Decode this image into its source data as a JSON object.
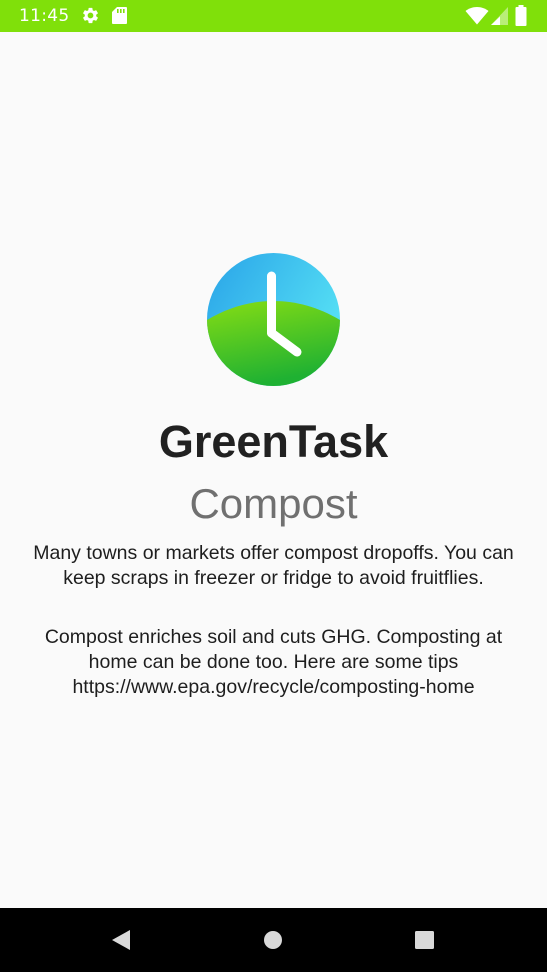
{
  "status_bar": {
    "time": "11:45",
    "background_color": "#80e00a",
    "left_icons": [
      "gear-icon",
      "sd-card-icon"
    ],
    "right_icons": [
      "wifi-icon",
      "cellular-signal-icon",
      "battery-icon"
    ]
  },
  "app": {
    "logo_icon": "clock-icon",
    "name": "GreenTask"
  },
  "screen": {
    "title": "Compost",
    "paragraphs": [
      "Many towns or markets offer compost dropoffs. You can keep scraps in freezer or fridge to avoid fruitflies.",
      "Compost enriches soil and cuts GHG. Composting at home can be done too. Here are some tips https://www.epa.gov/recycle/composting-home"
    ]
  },
  "nav_bar": {
    "buttons": [
      "back-icon",
      "home-icon",
      "recents-icon"
    ]
  }
}
